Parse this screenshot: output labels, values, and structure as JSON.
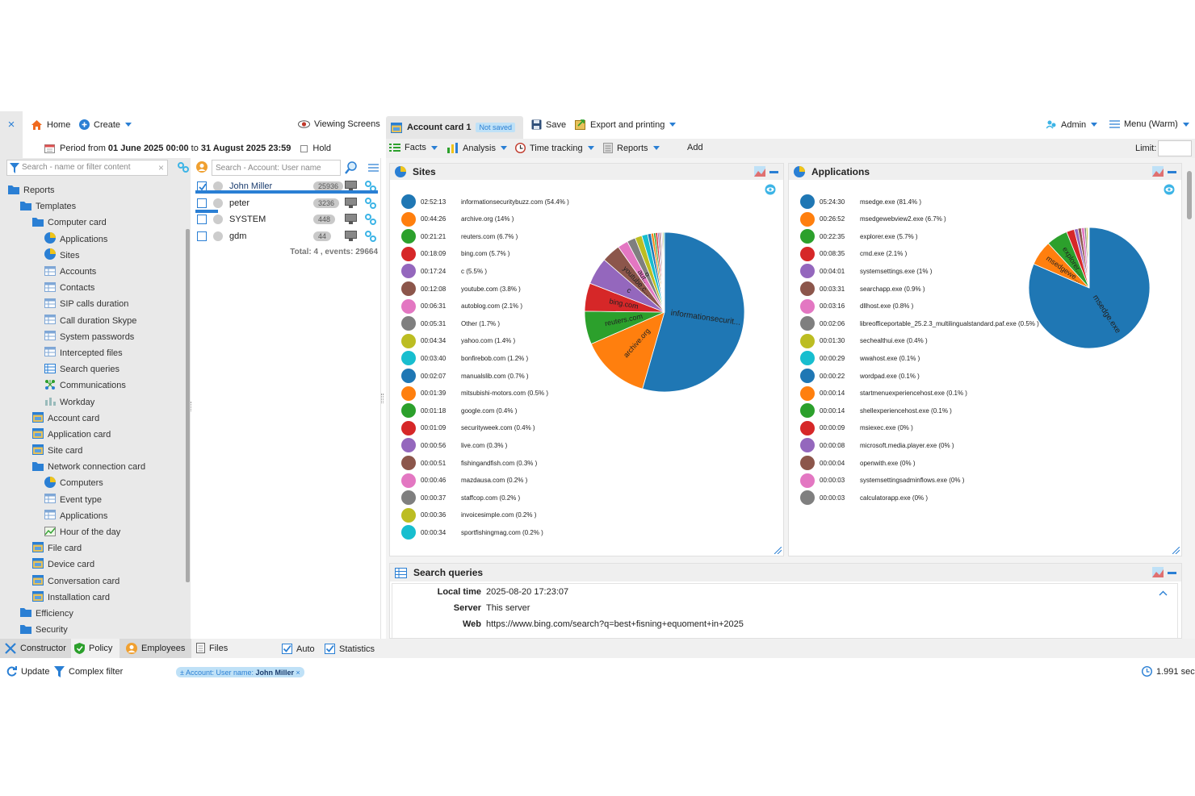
{
  "topbar": {
    "close": "×",
    "home": "Home",
    "create": "Create",
    "viewing": "Viewing Screens",
    "account_tab": "Account card 1",
    "not_saved": "Not saved",
    "save": "Save",
    "export": "Export and printing",
    "admin": "Admin",
    "menu": "Menu (Warm)"
  },
  "period": {
    "prefix": "Period from",
    "from": "01 June 2025 00:00",
    "to_word": "to",
    "to": "31 August 2025 23:59",
    "hold": "Hold"
  },
  "secbar": {
    "facts": "Facts",
    "analysis": "Analysis",
    "time_tracking": "Time tracking",
    "reports": "Reports",
    "add": "Add",
    "limit": "Limit:"
  },
  "left": {
    "search_placeholder": "Search - name or filter content",
    "tree": [
      {
        "label": "Reports",
        "level": 0,
        "icon": "folder"
      },
      {
        "label": "Templates",
        "level": 1,
        "icon": "folder"
      },
      {
        "label": "Computer card",
        "level": 2,
        "icon": "folder"
      },
      {
        "label": "Applications",
        "level": 3,
        "icon": "pie"
      },
      {
        "label": "Sites",
        "level": 3,
        "icon": "pie"
      },
      {
        "label": "Accounts",
        "level": 3,
        "icon": "table"
      },
      {
        "label": "Contacts",
        "level": 3,
        "icon": "table"
      },
      {
        "label": "SIP calls duration",
        "level": 3,
        "icon": "table"
      },
      {
        "label": "Call duration Skype",
        "level": 3,
        "icon": "table"
      },
      {
        "label": "System passwords",
        "level": 3,
        "icon": "table"
      },
      {
        "label": "Intercepted files",
        "level": 3,
        "icon": "table"
      },
      {
        "label": "Search queries",
        "level": 3,
        "icon": "list"
      },
      {
        "label": "Communications",
        "level": 3,
        "icon": "graph"
      },
      {
        "label": "Workday",
        "level": 3,
        "icon": "bars"
      },
      {
        "label": "Account card",
        "level": 2,
        "icon": "card"
      },
      {
        "label": "Application card",
        "level": 2,
        "icon": "card"
      },
      {
        "label": "Site card",
        "level": 2,
        "icon": "card"
      },
      {
        "label": "Network connection card",
        "level": 2,
        "icon": "folder"
      },
      {
        "label": "Computers",
        "level": 3,
        "icon": "pie"
      },
      {
        "label": "Event type",
        "level": 3,
        "icon": "table"
      },
      {
        "label": "Applications",
        "level": 3,
        "icon": "table"
      },
      {
        "label": "Hour of the day",
        "level": 3,
        "icon": "linechart"
      },
      {
        "label": "File card",
        "level": 2,
        "icon": "card"
      },
      {
        "label": "Device card",
        "level": 2,
        "icon": "card"
      },
      {
        "label": "Conversation card",
        "level": 2,
        "icon": "card"
      },
      {
        "label": "Installation card",
        "level": 2,
        "icon": "card"
      },
      {
        "label": "Efficiency",
        "level": 1,
        "icon": "folder"
      },
      {
        "label": "Security",
        "level": 1,
        "icon": "folder"
      }
    ]
  },
  "middle": {
    "search_placeholder": "Search - Account: User name",
    "users": [
      {
        "name": "John Miller",
        "count": "25936",
        "checked": true
      },
      {
        "name": "peter",
        "count": "3236",
        "checked": false
      },
      {
        "name": "SYSTEM",
        "count": "448",
        "checked": false
      },
      {
        "name": "gdm",
        "count": "44",
        "checked": false
      }
    ],
    "total": "Total: 4 , events: 29664"
  },
  "colors": [
    "#1f77b4",
    "#ff7f0e",
    "#2ca02c",
    "#d62728",
    "#9467bd",
    "#8c564b",
    "#e377c2",
    "#7f7f7f",
    "#bcbd22",
    "#17becf"
  ],
  "sites": {
    "title": "Sites",
    "legend": [
      {
        "time": "02:52:13",
        "label": "informationsecuritybuzz.com (54.4% )"
      },
      {
        "time": "00:44:26",
        "label": "archive.org (14% )"
      },
      {
        "time": "00:21:21",
        "label": "reuters.com (6.7% )"
      },
      {
        "time": "00:18:09",
        "label": "bing.com (5.7% )"
      },
      {
        "time": "00:17:24",
        "label": "c (5.5% )"
      },
      {
        "time": "00:12:08",
        "label": "youtube.com (3.8% )"
      },
      {
        "time": "00:06:31",
        "label": "autoblog.com (2.1% )"
      },
      {
        "time": "00:05:31",
        "label": "Other (1.7% )"
      },
      {
        "time": "00:04:34",
        "label": "yahoo.com (1.4% )"
      },
      {
        "time": "00:03:40",
        "label": "bonfirebob.com (1.2% )"
      },
      {
        "time": "00:02:07",
        "label": "manualslib.com (0.7% )"
      },
      {
        "time": "00:01:39",
        "label": "mitsubishi-motors.com (0.5% )"
      },
      {
        "time": "00:01:18",
        "label": "google.com (0.4% )"
      },
      {
        "time": "00:01:09",
        "label": "securityweek.com (0.4% )"
      },
      {
        "time": "00:00:56",
        "label": "live.com (0.3% )"
      },
      {
        "time": "00:00:51",
        "label": "fishingandfish.com (0.3% )"
      },
      {
        "time": "00:00:46",
        "label": "mazdausa.com (0.2% )"
      },
      {
        "time": "00:00:37",
        "label": "staffcop.com (0.2% )"
      },
      {
        "time": "00:00:36",
        "label": "invoicesimple.com (0.2% )"
      },
      {
        "time": "00:00:34",
        "label": "sportfishingmag.com (0.2% )"
      }
    ]
  },
  "apps": {
    "title": "Applications",
    "legend": [
      {
        "time": "05:24:30",
        "label": "msedge.exe (81.4% )"
      },
      {
        "time": "00:26:52",
        "label": "msedgewebview2.exe (6.7% )"
      },
      {
        "time": "00:22:35",
        "label": "explorer.exe (5.7% )"
      },
      {
        "time": "00:08:35",
        "label": "cmd.exe (2.1% )"
      },
      {
        "time": "00:04:01",
        "label": "systemsettings.exe (1% )"
      },
      {
        "time": "00:03:31",
        "label": "searchapp.exe (0.9% )"
      },
      {
        "time": "00:03:16",
        "label": "dllhost.exe (0.8% )"
      },
      {
        "time": "00:02:06",
        "label": "libreofficeportable_25.2.3_multilingualstandard.paf.exe (0.5% )"
      },
      {
        "time": "00:01:30",
        "label": "sechealthui.exe (0.4% )"
      },
      {
        "time": "00:00:29",
        "label": "wwahost.exe (0.1% )"
      },
      {
        "time": "00:00:22",
        "label": "wordpad.exe (0.1% )"
      },
      {
        "time": "00:00:14",
        "label": "startmenuexperiencehost.exe (0.1% )"
      },
      {
        "time": "00:00:14",
        "label": "shellexperiencehost.exe (0.1% )"
      },
      {
        "time": "00:00:09",
        "label": "msiexec.exe (0% )"
      },
      {
        "time": "00:00:08",
        "label": "microsoft.media.player.exe (0% )"
      },
      {
        "time": "00:00:04",
        "label": "openwith.exe (0% )"
      },
      {
        "time": "00:00:03",
        "label": "systemsettingsadminflows.exe (0% )"
      },
      {
        "time": "00:00:03",
        "label": "calculatorapp.exe (0% )"
      }
    ]
  },
  "chart_data": [
    {
      "type": "pie",
      "title": "Sites",
      "slice_labels": [
        "informationsecurit...",
        "archive.org",
        "reuters.com",
        "bing.com",
        "c",
        "youtube.c...",
        "aut..",
        "o"
      ],
      "categories": [
        "informationsecuritybuzz.com",
        "archive.org",
        "reuters.com",
        "bing.com",
        "c",
        "youtube.com",
        "autoblog.com",
        "Other",
        "yahoo.com",
        "bonfirebob.com",
        "manualslib.com",
        "mitsubishi-motors.com",
        "google.com",
        "securityweek.com",
        "live.com",
        "fishingandfish.com",
        "mazdausa.com",
        "staffcop.com",
        "invoicesimple.com",
        "sportfishingmag.com"
      ],
      "values": [
        54.4,
        14,
        6.7,
        5.7,
        5.5,
        3.8,
        2.1,
        1.7,
        1.4,
        1.2,
        0.7,
        0.5,
        0.4,
        0.4,
        0.3,
        0.3,
        0.2,
        0.2,
        0.2,
        0.2
      ]
    },
    {
      "type": "pie",
      "title": "Applications",
      "slice_labels": [
        "msedge.exe",
        "msedgewe...",
        "explorer..."
      ],
      "categories": [
        "msedge.exe",
        "msedgewebview2.exe",
        "explorer.exe",
        "cmd.exe",
        "systemsettings.exe",
        "searchapp.exe",
        "dllhost.exe",
        "libreofficeportable_25.2.3_multilingualstandard.paf.exe",
        "sechealthui.exe",
        "wwahost.exe",
        "wordpad.exe",
        "startmenuexperiencehost.exe",
        "shellexperiencehost.exe",
        "msiexec.exe",
        "microsoft.media.player.exe",
        "openwith.exe",
        "systemsettingsadminflows.exe",
        "calculatorapp.exe"
      ],
      "values": [
        81.4,
        6.7,
        5.7,
        2.1,
        1,
        0.9,
        0.8,
        0.5,
        0.4,
        0.1,
        0.1,
        0.1,
        0.1,
        0,
        0,
        0,
        0,
        0
      ]
    }
  ],
  "search_queries": {
    "title": "Search queries",
    "local_time_label": "Local time",
    "local_time": "2025-08-20 17:23:07",
    "server_label": "Server",
    "server": "This server",
    "web_label": "Web",
    "web": "https://www.bing.com/search?q=best+fisning+equoment+in+2025"
  },
  "bottombar": {
    "constructor": "Constructor",
    "policy": "Policy",
    "employees": "Employees",
    "files": "Files",
    "auto": "Auto",
    "statistics": "Statistics"
  },
  "statusbar": {
    "update": "Update",
    "complex_filter": "Complex filter",
    "filter_chip_prefix": "± Account: User name:",
    "filter_chip_value": "John Miller",
    "filter_chip_close": "×",
    "timing": "1.991 sec"
  }
}
